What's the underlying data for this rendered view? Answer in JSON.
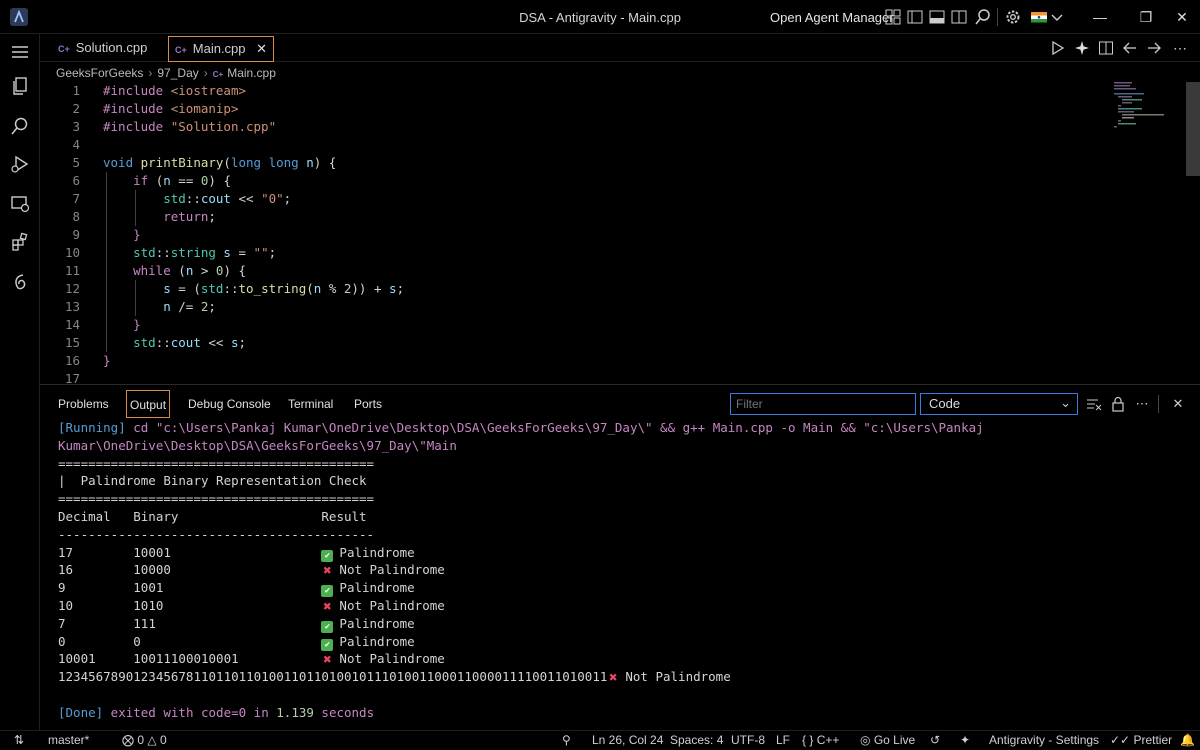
{
  "window": {
    "title": "DSA - Antigravity - Main.cpp",
    "agent_manager": "Open Agent Manager"
  },
  "tabs": [
    {
      "label": "Solution.cpp",
      "active": false
    },
    {
      "label": "Main.cpp",
      "active": true
    }
  ],
  "file_icon_text": "C+",
  "breadcrumb": [
    "GeeksForGeeks",
    "97_Day",
    "Main.cpp"
  ],
  "editor": {
    "line_numbers": [
      "1",
      "2",
      "3",
      "4",
      "5",
      "6",
      "7",
      "8",
      "9",
      "10",
      "11",
      "12",
      "13",
      "14",
      "15",
      "16",
      "17"
    ],
    "code": {
      "l1_kw": "#include",
      "l1_str": " <iostream>",
      "l2_kw": "#include",
      "l2_str": " <iomanip>",
      "l3_kw": "#include",
      "l3_str": " \"Solution.cpp\"",
      "l5_void": "void",
      "l5_fn": " printBinary",
      "l5_p1": "(",
      "l5_type": "long long",
      "l5_n": " n",
      "l5_p2": ") {",
      "l6_if": "if",
      "l6_a": " (",
      "l6_n": "n",
      "l6_b": " == ",
      "l6_num": "0",
      "l6_c": ") {",
      "l7_ns": "std",
      "l7_a": "::",
      "l7_var": "cout",
      "l7_b": " << ",
      "l7_str": "\"0\"",
      "l7_c": ";",
      "l8_ret": "return",
      "l8_c": ";",
      "l9": "}",
      "l10_ns": "std",
      "l10_a": "::",
      "l10_type": "string",
      "l10_var": " s",
      "l10_b": " = ",
      "l10_str": "\"\"",
      "l10_c": ";",
      "l11_while": "while",
      "l11_a": " (",
      "l11_n": "n",
      "l11_b": " > ",
      "l11_num": "0",
      "l11_c": ") {",
      "l12_s": "s",
      "l12_a": " = (",
      "l12_ns": "std",
      "l12_b": "::",
      "l12_fn": "to_string",
      "l12_c": "(",
      "l12_n": "n",
      "l12_d": " % ",
      "l12_num": "2",
      "l12_e": ")) + ",
      "l12_s2": "s",
      "l12_f": ";",
      "l13_n": "n",
      "l13_a": " /= ",
      "l13_num": "2",
      "l13_b": ";",
      "l14": "}",
      "l15_ns": "std",
      "l15_a": "::",
      "l15_var": "cout",
      "l15_b": " << ",
      "l15_s": "s",
      "l15_c": ";",
      "l16": "}"
    }
  },
  "panel": {
    "tabs": [
      "Problems",
      "Output",
      "Debug Console",
      "Terminal",
      "Ports"
    ],
    "active_tab": "Output",
    "filter_placeholder": "Filter",
    "channel": "Code",
    "output": {
      "running_tag": "[Running]",
      "cmd_1": " cd \"c:\\Users\\Pankaj Kumar\\OneDrive\\Desktop\\DSA\\GeeksForGeeks\\97_Day\\\" && g++ Main.cpp -o Main && \"c:\\Users\\Pankaj",
      "cmd_2": "Kumar\\OneDrive\\Desktop\\DSA\\GeeksForGeeks\\97_Day\\\"Main",
      "rule_eq": "==========================================",
      "heading": "|  Palindrome Binary Representation Check",
      "header": "Decimal   Binary                   Result",
      "rule_dash": "------------------------------------------",
      "rows": [
        {
          "decimal": "17",
          "binary": "10001",
          "pal": true,
          "result": "Palindrome"
        },
        {
          "decimal": "16",
          "binary": "10000",
          "pal": false,
          "result": "Not Palindrome"
        },
        {
          "decimal": "9",
          "binary": "1001",
          "pal": true,
          "result": "Palindrome"
        },
        {
          "decimal": "10",
          "binary": "1010",
          "pal": false,
          "result": "Not Palindrome"
        },
        {
          "decimal": "7",
          "binary": "111",
          "pal": true,
          "result": "Palindrome"
        },
        {
          "decimal": "0",
          "binary": "0",
          "pal": true,
          "result": "Palindrome"
        },
        {
          "decimal": "10001",
          "binary": "10011100010001",
          "pal": false,
          "result": "Not Palindrome"
        }
      ],
      "long_row": {
        "text": "1234567890123456781101101101001101101001011101001100011000011110011010011",
        "result": "Not Palindrome"
      },
      "done_tag": "[Done]",
      "done_a": " exited with ",
      "done_code": "code=0",
      "done_b": " in ",
      "done_time": "1.139",
      "done_c": " seconds"
    }
  },
  "statusbar": {
    "branch": "master*",
    "errors": "0",
    "warnings": "0",
    "position": "Ln 26, Col 24",
    "spaces": "Spaces: 4",
    "encoding": "UTF-8",
    "eol": "LF",
    "language": "C++",
    "golive": "Go Live",
    "settings": "Antigravity - Settings",
    "prettier": "Prettier"
  },
  "colors": {
    "accent_border": "#d98c46",
    "input_border": "#3c7bd9",
    "keyword": "#569cd6",
    "string": "#ce9178",
    "success": "#4caf50",
    "error": "#e8475f"
  }
}
